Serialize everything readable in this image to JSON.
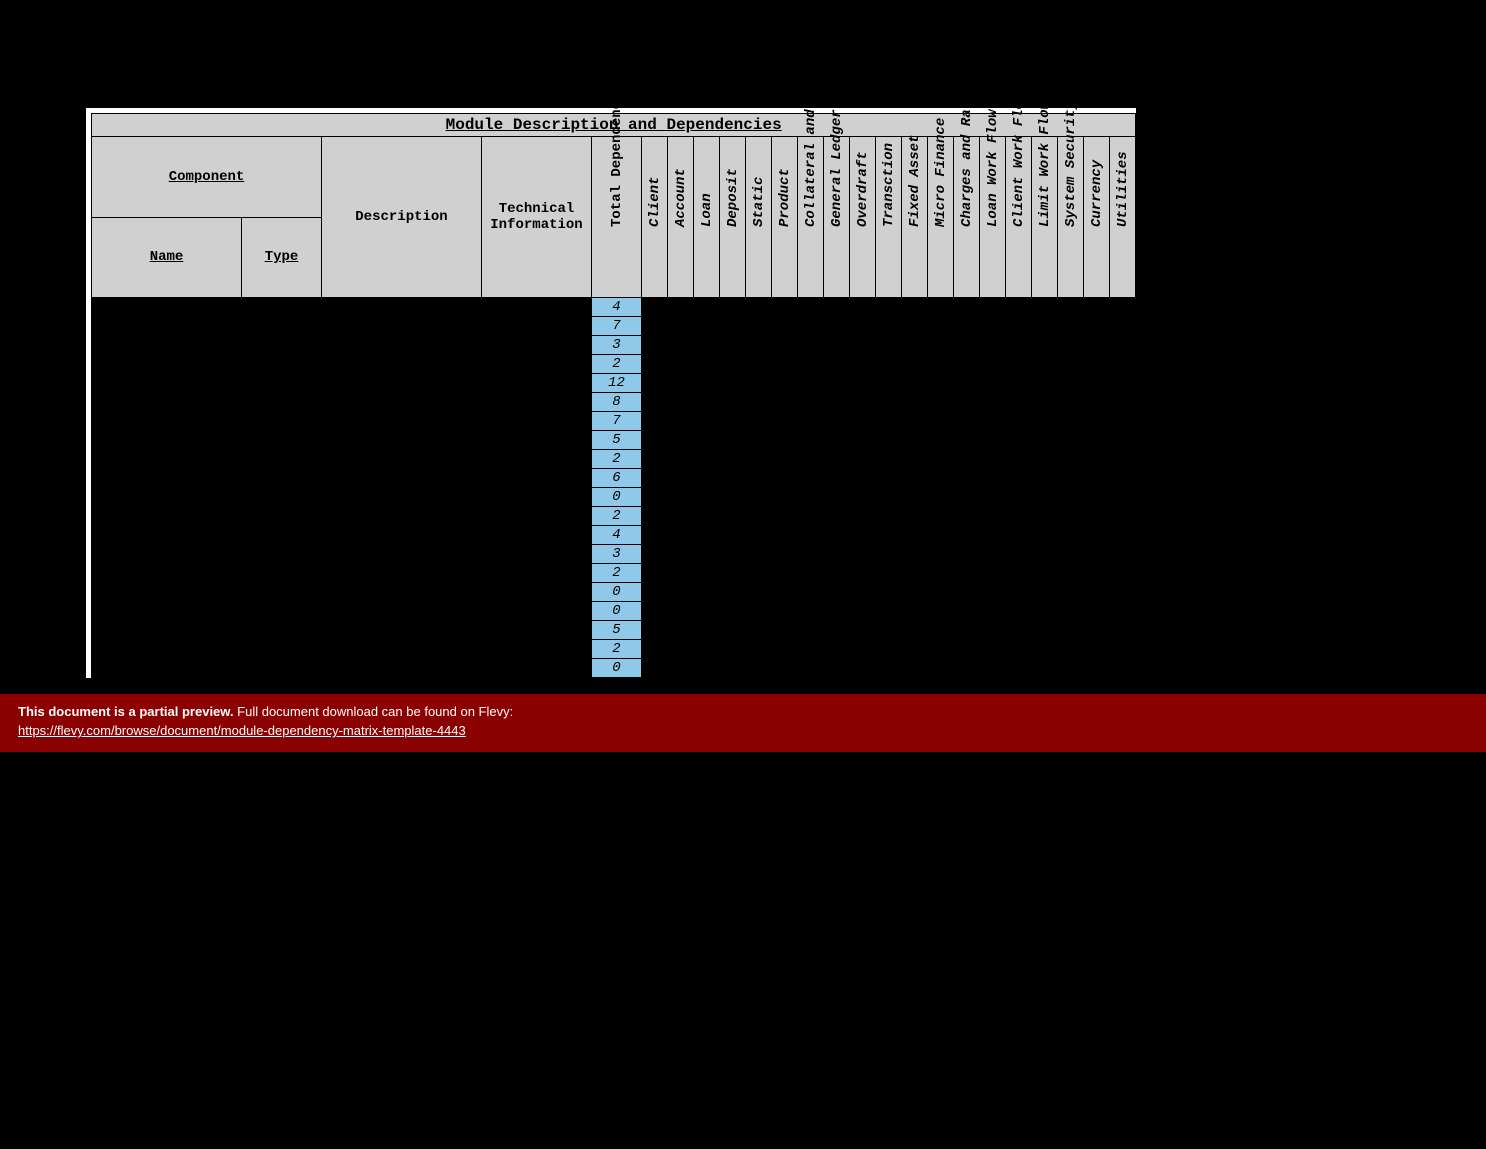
{
  "title": "Module Description and Dependencies",
  "headers": {
    "component": "Component",
    "name": "Name",
    "type": "Type",
    "description": "Description",
    "technical": "Technical Information",
    "total_deps": "Total Dependencies"
  },
  "modules": [
    "Client",
    "Account",
    "Loan",
    "Deposit",
    "Static",
    "Product",
    "Collateral and Limit",
    "General Ledger",
    "Overdraft",
    "Transction",
    "Fixed Asset",
    "Micro Finance",
    "Charges and Rates",
    "Loan Work Flow",
    "Client Work Flow",
    "Limit Work Flow",
    "System Security",
    "Currency",
    "Utilities"
  ],
  "total_values": [
    "4",
    "7",
    "3",
    "2",
    "12",
    "8",
    "7",
    "5",
    "2",
    "6",
    "0",
    "2",
    "4",
    "3",
    "2",
    "0",
    "0",
    "5",
    "2",
    "0"
  ],
  "banner": {
    "bold": "This document is a partial preview.",
    "rest": "Full document download can be found on Flevy:",
    "link": "https://flevy.com/browse/document/module-dependency-matrix-template-4443"
  }
}
